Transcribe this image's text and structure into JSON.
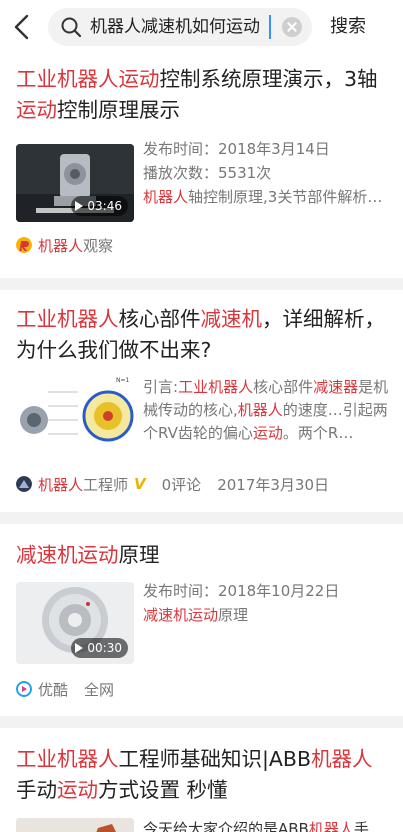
{
  "header": {
    "search_query": "机器人减速机如何运动",
    "search_button": "搜索"
  },
  "results": [
    {
      "title_parts": [
        "工业机器人运动",
        "控制系统原理演示，3轴",
        "运动",
        "控制原理展示"
      ],
      "duration": "03:46",
      "publish": "发布时间：2018年3月14日",
      "plays": "播放次数：5531次",
      "desc_parts": [
        "机器人",
        "轴控制原理,3关节部件解析…"
      ],
      "source_parts": [
        "机器人",
        "观察"
      ]
    },
    {
      "title_parts": [
        "工业机器人",
        "核心部件",
        "减速机",
        "，详细解析，为什么我们做不出来?"
      ],
      "desc_parts": [
        "引言:",
        "工业机器人",
        "核心部件",
        "减速器",
        "是机械传动的核心,",
        "机器人",
        "的速度…引起两个RV齿轮的偏心",
        "运动",
        "。两个R…"
      ],
      "source_parts": [
        "机器人",
        "工程师"
      ],
      "verified": "V",
      "comments": "0评论",
      "date": "2017年3月30日"
    },
    {
      "title_parts": [
        "减速机运动",
        "原理"
      ],
      "duration": "00:30",
      "publish": "发布时间：2018年10月22日",
      "desc_parts": [
        "减速机运动",
        "原理"
      ],
      "source": "优酷",
      "scope": "全网"
    },
    {
      "title_parts": [
        "工业机器人",
        "工程师基础知识|ABB",
        "机器人",
        "手动",
        "运动",
        "方式设置 秒懂"
      ],
      "desc_parts": [
        "今天给大家介绍的是ABB",
        "机器人",
        "手"
      ]
    }
  ],
  "colors": {
    "highlight": "#d9363b",
    "verified": "#e8b400",
    "caret": "#3b8cff"
  }
}
